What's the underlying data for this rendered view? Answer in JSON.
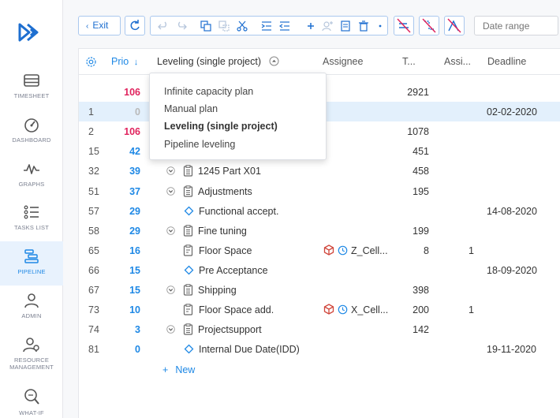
{
  "toolbar": {
    "exit_label": "Exit",
    "date_range_placeholder": "Date range"
  },
  "sidebar": {
    "items": [
      {
        "label": "TIMESHEET",
        "icon": "timesheet-icon"
      },
      {
        "label": "DASHBOARD",
        "icon": "dashboard-icon"
      },
      {
        "label": "GRAPHS",
        "icon": "graphs-icon"
      },
      {
        "label": "TASKS LIST",
        "icon": "tasks-list-icon"
      },
      {
        "label": "PIPELINE",
        "icon": "pipeline-icon",
        "active": true
      },
      {
        "label": "ADMIN",
        "icon": "admin-icon"
      },
      {
        "label": "RESOURCE MANAGEMENT",
        "icon": "resource-management-icon"
      },
      {
        "label": "WHAT-IF",
        "icon": "what-if-icon"
      }
    ]
  },
  "columns": {
    "prio": "Prio",
    "sort_indicator": "↓",
    "name": "Leveling (single project)",
    "assignee": "Assignee",
    "t": "T...",
    "assi": "Assi...",
    "deadline": "Deadline"
  },
  "leveling_menu": {
    "options": [
      "Infinite capacity plan",
      "Manual plan",
      "Leveling (single project)",
      "Pipeline leveling"
    ],
    "selected": "Leveling (single project)"
  },
  "rows": [
    {
      "num": "",
      "prio": "106",
      "prio_color": "red",
      "name": "",
      "t": "2921",
      "assi": "",
      "deadline": ""
    },
    {
      "num": "1",
      "prio": "0",
      "prio_color": "gray",
      "name": "",
      "t": "",
      "assi": "",
      "deadline": "02-02-2020",
      "selected": true
    },
    {
      "num": "2",
      "prio": "106",
      "prio_color": "red",
      "name": "",
      "t": "1078",
      "assi": "",
      "deadline": ""
    },
    {
      "num": "15",
      "prio": "42",
      "prio_color": "blue",
      "name": "",
      "t": "451",
      "assi": "",
      "deadline": ""
    },
    {
      "num": "32",
      "prio": "39",
      "prio_color": "blue",
      "name": "1245 Part X01",
      "kind": "group",
      "t": "458",
      "assi": "",
      "deadline": ""
    },
    {
      "num": "51",
      "prio": "37",
      "prio_color": "blue",
      "name": "Adjustments",
      "kind": "group",
      "t": "195",
      "assi": "",
      "deadline": ""
    },
    {
      "num": "57",
      "prio": "29",
      "prio_color": "blue",
      "name": "Functional accept.",
      "kind": "milestone",
      "t": "",
      "assi": "",
      "deadline": "14-08-2020"
    },
    {
      "num": "58",
      "prio": "29",
      "prio_color": "blue",
      "name": "Fine tuning",
      "kind": "group",
      "t": "199",
      "assi": "",
      "deadline": ""
    },
    {
      "num": "65",
      "prio": "16",
      "prio_color": "blue",
      "name": "Floor Space",
      "kind": "task",
      "assignee": "Z_Cell...",
      "t": "8",
      "assi": "1",
      "deadline": ""
    },
    {
      "num": "66",
      "prio": "15",
      "prio_color": "blue",
      "name": "Pre Acceptance",
      "kind": "milestone",
      "t": "",
      "assi": "",
      "deadline": "18-09-2020"
    },
    {
      "num": "67",
      "prio": "15",
      "prio_color": "blue",
      "name": "Shipping",
      "kind": "group",
      "t": "398",
      "assi": "",
      "deadline": ""
    },
    {
      "num": "73",
      "prio": "10",
      "prio_color": "blue",
      "name": "Floor Space add.",
      "kind": "task",
      "assignee": "X_Cell...",
      "t": "200",
      "assi": "1",
      "deadline": ""
    },
    {
      "num": "74",
      "prio": "3",
      "prio_color": "blue",
      "name": "Projectsupport",
      "kind": "group",
      "t": "142",
      "assi": "",
      "deadline": ""
    },
    {
      "num": "81",
      "prio": "0",
      "prio_color": "blue",
      "name": "Internal Due Date(IDD)",
      "kind": "milestone",
      "t": "",
      "assi": "",
      "deadline": "19-11-2020"
    }
  ],
  "new_label": "New",
  "colors": {
    "accent": "#1e88e5",
    "prio_red": "#e0245e",
    "selected_row": "#e3f0fc"
  }
}
